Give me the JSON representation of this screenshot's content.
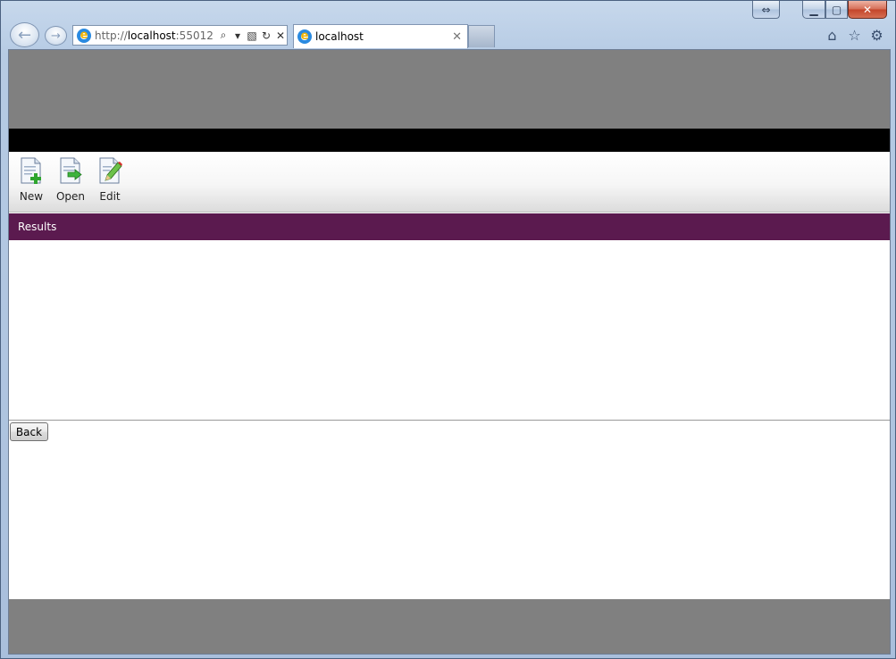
{
  "browser": {
    "address": {
      "url_prefix": "http://",
      "url_host": "localhost",
      "url_rest": ":55012/P..."
    },
    "tab": {
      "title": "localhost"
    }
  },
  "toolbar": {
    "new_label": "New",
    "open_label": "Open",
    "edit_label": "Edit"
  },
  "results": {
    "title": "Results"
  },
  "actions": {
    "back_label": "Back"
  },
  "colors": {
    "header_gray": "#808080",
    "black_bar": "#000000",
    "results_bar": "#5b1a4f"
  }
}
